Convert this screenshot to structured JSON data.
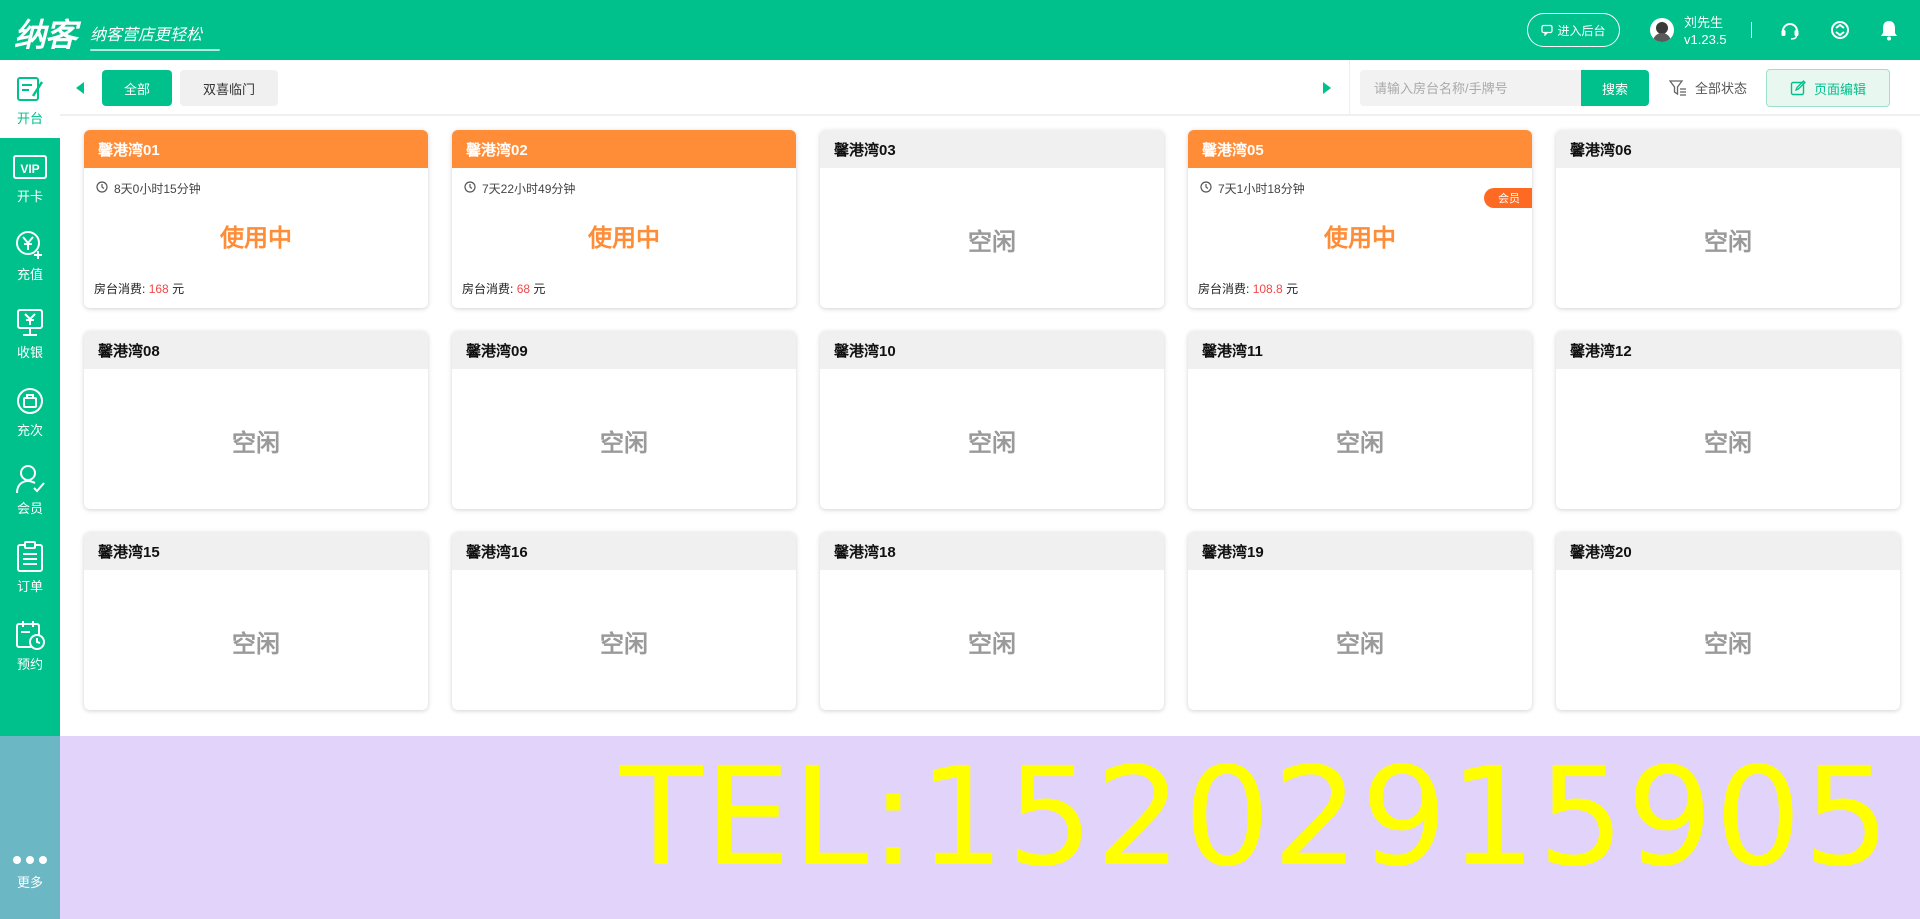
{
  "header": {
    "logo_text": "纳客",
    "slogan": "纳客营店更轻松",
    "enter_backend_label": "进入后台",
    "user_name": "刘先生",
    "version": "v1.23.5",
    "brand_color": "#00c08b"
  },
  "sidebar": {
    "items": [
      {
        "label": "开台",
        "icon": "open-table-icon"
      },
      {
        "label": "开卡",
        "icon": "vip-card-icon"
      },
      {
        "label": "充值",
        "icon": "recharge-icon"
      },
      {
        "label": "收银",
        "icon": "cashier-icon"
      },
      {
        "label": "充次",
        "icon": "recharge-count-icon"
      },
      {
        "label": "会员",
        "icon": "member-icon"
      },
      {
        "label": "订单",
        "icon": "order-icon"
      },
      {
        "label": "预约",
        "icon": "reservation-icon"
      }
    ],
    "more_label": "更多"
  },
  "toolbar": {
    "tabs": [
      {
        "label": "全部"
      },
      {
        "label": "双喜临门"
      }
    ],
    "search_placeholder": "请输入房台名称/手牌号",
    "search_label": "搜索",
    "filter_label": "全部状态",
    "edit_label": "页面编辑"
  },
  "card_fee_label": "房台消费:",
  "card_fee_unit": "元",
  "rooms": [
    {
      "name": "馨港湾01",
      "busy": true,
      "time": "8天0小时15分钟",
      "status": "使用中",
      "fee": "168"
    },
    {
      "name": "馨港湾02",
      "busy": true,
      "time": "7天22小时49分钟",
      "status": "使用中",
      "fee": "68"
    },
    {
      "name": "馨港湾03",
      "busy": false,
      "status": "空闲"
    },
    {
      "name": "馨港湾05",
      "busy": true,
      "time": "7天1小时18分钟",
      "status": "使用中",
      "fee": "108.8",
      "badge": "会员"
    },
    {
      "name": "馨港湾06",
      "busy": false,
      "status": "空闲"
    },
    {
      "name": "馨港湾08",
      "busy": false,
      "status": "空闲"
    },
    {
      "name": "馨港湾09",
      "busy": false,
      "status": "空闲"
    },
    {
      "name": "馨港湾10",
      "busy": false,
      "status": "空闲"
    },
    {
      "name": "馨港湾11",
      "busy": false,
      "status": "空闲"
    },
    {
      "name": "馨港湾12",
      "busy": false,
      "status": "空闲"
    },
    {
      "name": "馨港湾15",
      "busy": false,
      "status": "空闲"
    },
    {
      "name": "馨港湾16",
      "busy": false,
      "status": "空闲"
    },
    {
      "name": "馨港湾18",
      "busy": false,
      "status": "空闲"
    },
    {
      "name": "馨港湾19",
      "busy": false,
      "status": "空闲"
    },
    {
      "name": "馨港湾20",
      "busy": false,
      "status": "空闲"
    }
  ],
  "banner": {
    "tel_text": "TEL:15202915905",
    "text_color": "#ffff00",
    "background": "#e2d3fb"
  },
  "colors": {
    "busy": "#ff8c37",
    "fee": "#f04848",
    "member_badge": "#ff6a22"
  }
}
